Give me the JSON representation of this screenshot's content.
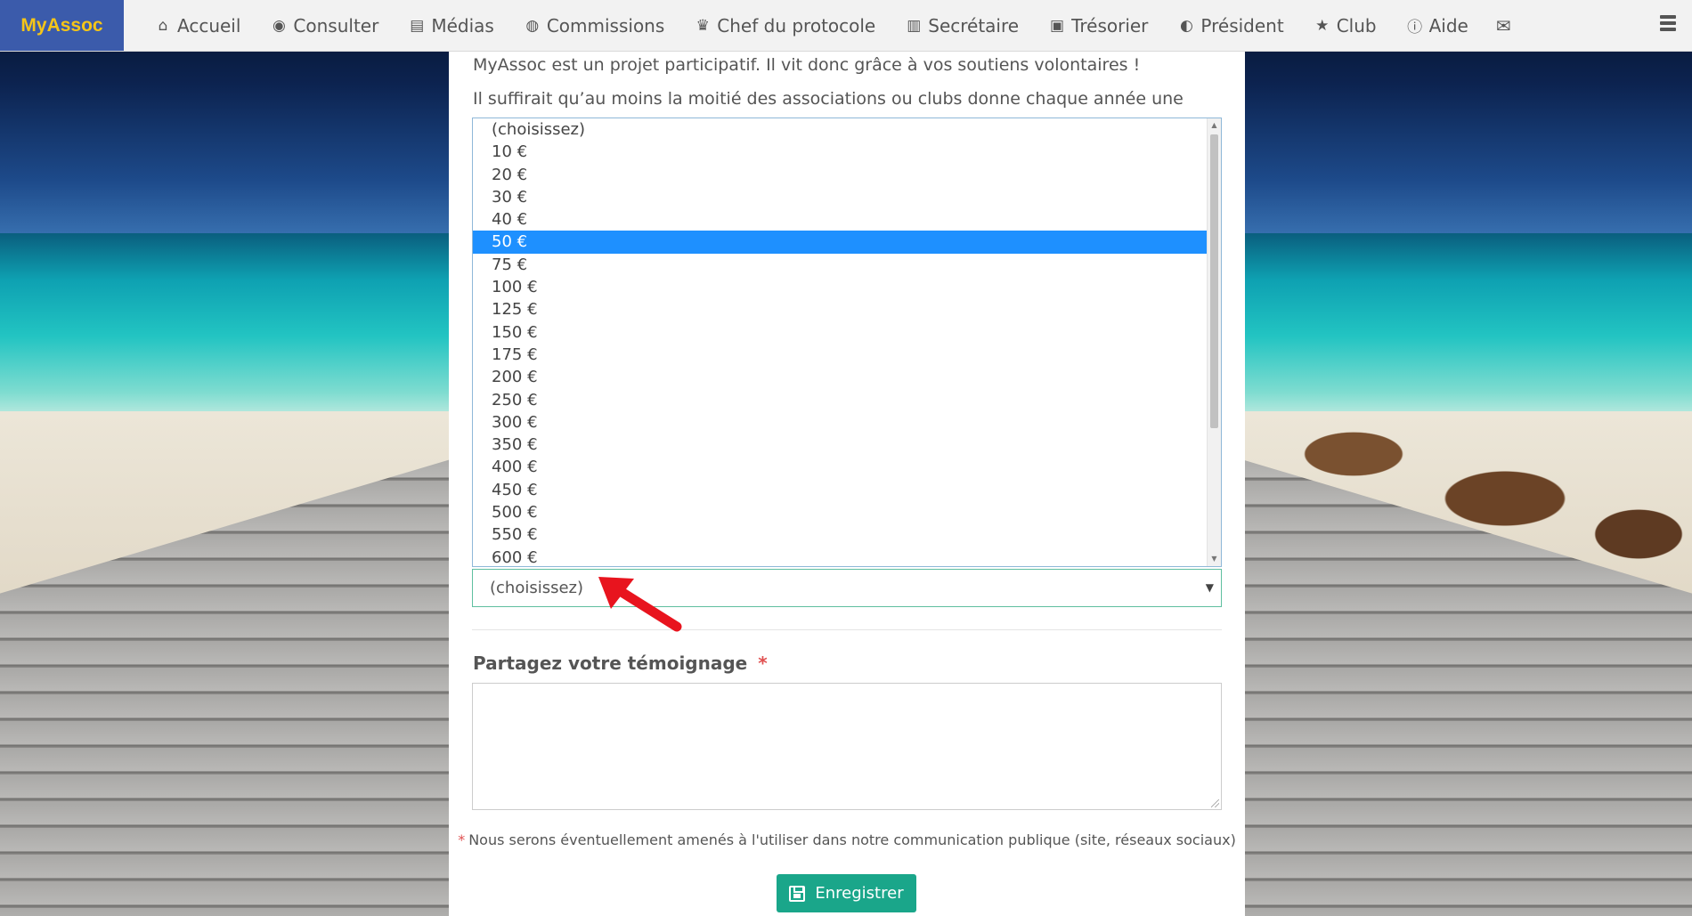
{
  "navbar": {
    "brand": "MyAssoc",
    "items": [
      {
        "label": "Accueil",
        "icon": "home-icon",
        "glyph": "⌂"
      },
      {
        "label": "Consulter",
        "icon": "eye-icon",
        "glyph": "◉"
      },
      {
        "label": "Médias",
        "icon": "file-icon",
        "glyph": "▤"
      },
      {
        "label": "Commissions",
        "icon": "user-circle-icon",
        "glyph": "◍"
      },
      {
        "label": "Chef du protocole",
        "icon": "trophy-icon",
        "glyph": "♛"
      },
      {
        "label": "Secrétaire",
        "icon": "book-icon",
        "glyph": "▥"
      },
      {
        "label": "Trésorier",
        "icon": "money-icon",
        "glyph": "▣"
      },
      {
        "label": "Président",
        "icon": "globe-icon",
        "glyph": "◐"
      },
      {
        "label": "Club",
        "icon": "star-icon",
        "glyph": "★"
      },
      {
        "label": "Aide",
        "icon": "info-icon",
        "glyph": "ⓘ"
      }
    ],
    "envelope_glyph": "✉"
  },
  "intro": {
    "line1": "MyAssoc est un projet participatif. Il vit donc grâce à vos soutiens volontaires !",
    "line2": "Il suffirait qu’au moins la moitié des associations ou clubs donne chaque année une somme symbolique pour que MyAssoc se développe et continue à vous aider au quotidien."
  },
  "donation_select": {
    "value": "(choisissez)",
    "options": [
      "(choisissez)",
      "10 €",
      "20 €",
      "30 €",
      "40 €",
      "50 €",
      "75 €",
      "100 €",
      "125 €",
      "150 €",
      "175 €",
      "200 €",
      "250 €",
      "300 €",
      "350 €",
      "400 €",
      "450 €",
      "500 €",
      "550 €",
      "600 €"
    ],
    "highlighted": "50 €"
  },
  "testimony": {
    "label": "Partagez votre témoignage",
    "required_mark": "*",
    "value": ""
  },
  "note": {
    "star": "*",
    "text": "Nous serons éventuellement amenés à l'utiliser dans notre communication publique (site, réseaux sociaux)"
  },
  "save_button": {
    "label": "Enregistrer"
  },
  "colors": {
    "brand_bg": "#3b5bab",
    "brand_text": "#f5c518",
    "selected_option": "#1e90ff",
    "save_button": "#1aa68a",
    "required": "#e05050",
    "annotation_arrow": "#e8141e"
  }
}
